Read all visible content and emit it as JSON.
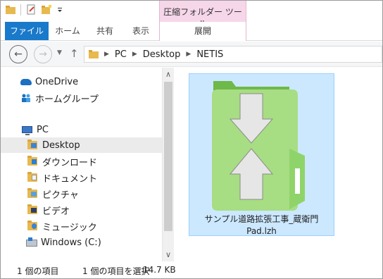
{
  "ribbon": {
    "context_title": "圧縮フォルダー ツール",
    "tabs": [
      "ファイル",
      "ホーム",
      "共有",
      "表示",
      "展開"
    ]
  },
  "address": {
    "crumbs": [
      "PC",
      "Desktop",
      "NETIS"
    ]
  },
  "navpane": {
    "items": [
      {
        "label": "OneDrive",
        "icon": "onedrive-cloud-icon"
      },
      {
        "label": "ホームグループ",
        "icon": "homegroup-icon"
      },
      {
        "label": "PC",
        "icon": "pc-icon"
      },
      {
        "label": "Desktop",
        "icon": "desktop-folder-icon",
        "selected": true
      },
      {
        "label": "ダウンロード",
        "icon": "downloads-folder-icon"
      },
      {
        "label": "ドキュメント",
        "icon": "documents-folder-icon"
      },
      {
        "label": "ピクチャ",
        "icon": "pictures-folder-icon"
      },
      {
        "label": "ビデオ",
        "icon": "videos-folder-icon"
      },
      {
        "label": "ミュージック",
        "icon": "music-folder-icon"
      },
      {
        "label": "Windows (C:)",
        "icon": "drive-icon"
      }
    ]
  },
  "content": {
    "file": {
      "name_line1": "サンプル道路拡張工事_蔵衛門",
      "name_line2": "Pad.lzh",
      "icon": "compressed-folder-icon"
    }
  },
  "status": {
    "count": "1 個の項目",
    "selected": "1 個の項目を選択",
    "size": "14.7 KB"
  },
  "colors": {
    "file_tab": "#1979ca",
    "context_tab": "#f6d7ea",
    "selection": "#cce8ff",
    "zip_green": "#8fd46a"
  }
}
